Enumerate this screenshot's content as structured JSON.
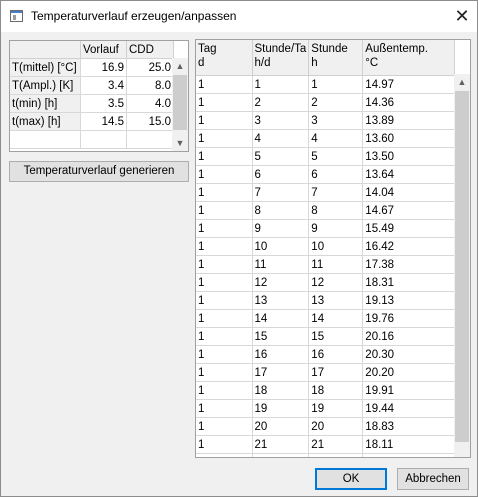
{
  "window": {
    "title": "Temperaturverlauf erzeugen/anpassen",
    "close_glyph": "✕"
  },
  "params": {
    "columns": [
      "Vorlauf",
      "CDD"
    ],
    "rows": [
      {
        "label": "T(mittel) [°C]",
        "values": [
          "16.9",
          "25.0"
        ]
      },
      {
        "label": "T(Ampl.) [K]",
        "values": [
          "3.4",
          "8.0"
        ]
      },
      {
        "label": "t(min) [h]",
        "values": [
          "3.5",
          "4.0"
        ]
      },
      {
        "label": "t(max) [h]",
        "values": [
          "14.5",
          "15.0"
        ]
      }
    ]
  },
  "generate_button": "Temperaturverlauf generieren",
  "table": {
    "headers": [
      [
        "Tag",
        "d"
      ],
      [
        "Stunde/Ta",
        "h/d"
      ],
      [
        "Stunde",
        "h"
      ],
      [
        "Außentemp.",
        "°C"
      ]
    ],
    "rows": [
      [
        "1",
        "1",
        "1",
        "14.97"
      ],
      [
        "1",
        "2",
        "2",
        "14.36"
      ],
      [
        "1",
        "3",
        "3",
        "13.89"
      ],
      [
        "1",
        "4",
        "4",
        "13.60"
      ],
      [
        "1",
        "5",
        "5",
        "13.50"
      ],
      [
        "1",
        "6",
        "6",
        "13.64"
      ],
      [
        "1",
        "7",
        "7",
        "14.04"
      ],
      [
        "1",
        "8",
        "8",
        "14.67"
      ],
      [
        "1",
        "9",
        "9",
        "15.49"
      ],
      [
        "1",
        "10",
        "10",
        "16.42"
      ],
      [
        "1",
        "11",
        "11",
        "17.38"
      ],
      [
        "1",
        "12",
        "12",
        "18.31"
      ],
      [
        "1",
        "13",
        "13",
        "19.13"
      ],
      [
        "1",
        "14",
        "14",
        "19.76"
      ],
      [
        "1",
        "15",
        "15",
        "20.16"
      ],
      [
        "1",
        "16",
        "16",
        "20.30"
      ],
      [
        "1",
        "17",
        "17",
        "20.20"
      ],
      [
        "1",
        "18",
        "18",
        "19.91"
      ],
      [
        "1",
        "19",
        "19",
        "19.44"
      ],
      [
        "1",
        "20",
        "20",
        "18.83"
      ],
      [
        "1",
        "21",
        "21",
        "18.11"
      ],
      [
        "1",
        "22",
        "22",
        "17.31"
      ]
    ]
  },
  "buttons": {
    "ok": "OK",
    "cancel": "Abbrechen"
  },
  "scroll": {
    "up": "▲",
    "down": "▼"
  }
}
